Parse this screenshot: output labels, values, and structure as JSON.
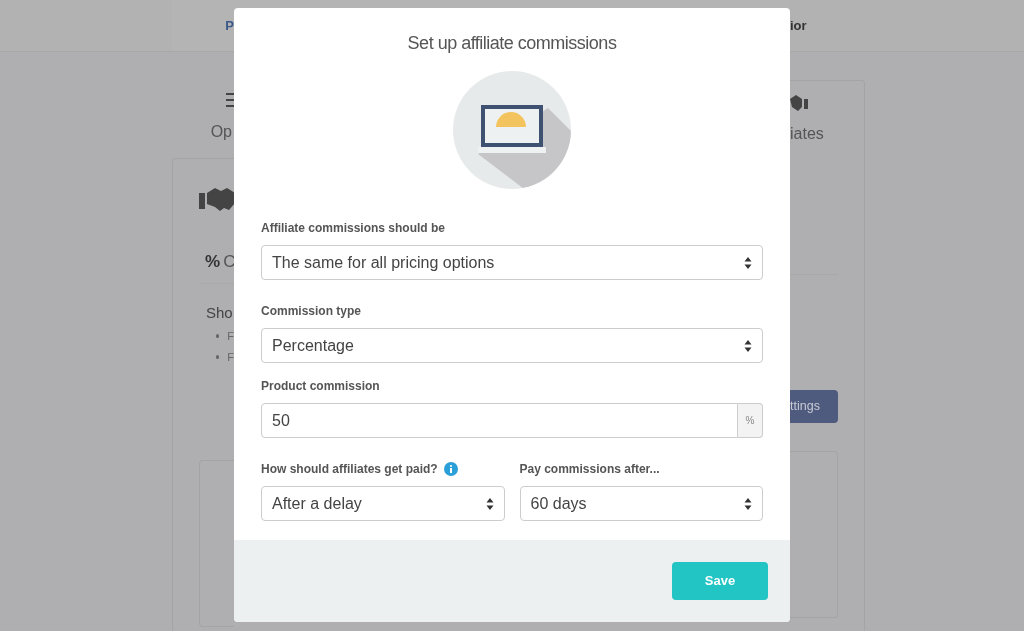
{
  "background": {
    "top_tab_left": "P",
    "top_tab_right": "ior",
    "option_left": "Op",
    "option_right": "iates",
    "percent_sign": "%",
    "section_heading": "C",
    "section_text": "Sho",
    "bullets": [
      "F",
      "F"
    ],
    "settings_button": "ttings"
  },
  "modal": {
    "title": "Set up affiliate commissions",
    "fields": [
      {
        "kind": "select",
        "label": "Affiliate commissions should be",
        "value": "The same for all pricing options"
      },
      {
        "kind": "select",
        "label": "Commission type",
        "value": "Percentage"
      },
      {
        "kind": "addon",
        "label": "Product commission",
        "value": "50",
        "addon": "%"
      }
    ],
    "pair": [
      {
        "kind": "select",
        "label": "How should affiliates get paid?",
        "value": "After a delay",
        "info": true
      },
      {
        "kind": "select",
        "label": "Pay commissions after...",
        "value": "60 days",
        "info": false
      }
    ],
    "save_button": "Save"
  }
}
